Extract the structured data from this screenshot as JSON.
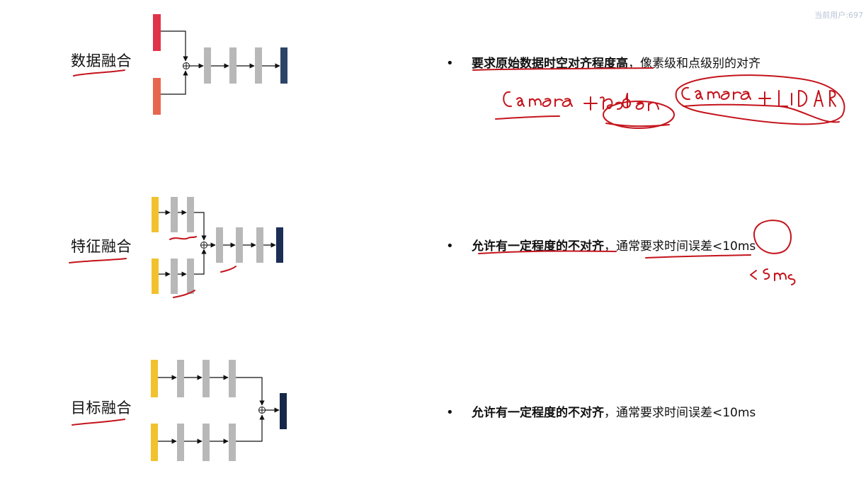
{
  "watermark": "当前用户:697",
  "rows": [
    {
      "label": "数据融合",
      "bullet": {
        "dot": "•",
        "strong": "要求原始数据时空对齐程度高",
        "rest": "，像素级和点级别的对齐"
      },
      "handwriting": "camera + radar  camera + LiDAR"
    },
    {
      "label": "特征融合",
      "bullet": {
        "dot": "•",
        "strong": "允许有一定程度的不对齐",
        "rest": "，通常要求时间误差<10ms"
      },
      "handwriting": "<5ms"
    },
    {
      "label": "目标融合",
      "bullet": {
        "dot": "•",
        "strong": "允许有一定程度的不对齐",
        "rest": "，通常要求时间误差<10ms"
      }
    }
  ],
  "colors": {
    "input_red": "#e0334a",
    "input_orange": "#e8664f",
    "input_yellow": "#f2c12e",
    "layer_gray": "#b8b8b8",
    "output_navy": "#1e3457",
    "annotation_red": "#c4141c"
  }
}
